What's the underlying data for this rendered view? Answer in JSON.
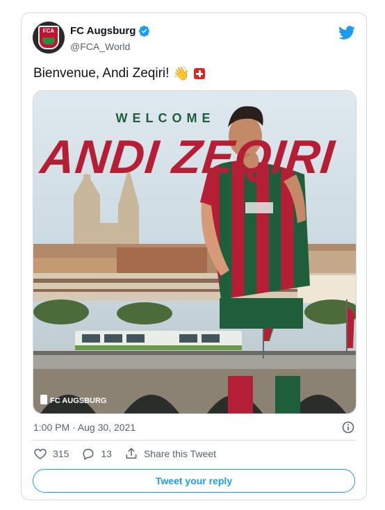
{
  "tweet": {
    "display_name": "FC Augsburg",
    "handle": "@FCA_World",
    "verified": true,
    "text": "Bienvenue, Andi Zeqiri!",
    "emojis": [
      "waving-hands-emoji",
      "swiss-flag-emoji"
    ],
    "timestamp": "1:00 PM · Aug 30, 2021"
  },
  "avatar": {
    "crest_text": "FCA"
  },
  "media": {
    "heading": "WELCOME",
    "player_name": "ANDI ZEQIRI",
    "watermark": "FC AUGSBURG",
    "colors": {
      "red": "#b51f36",
      "green": "#1f5e3a",
      "sky": "#cfdde6"
    }
  },
  "actions": {
    "likes": "315",
    "replies": "13",
    "share_label": "Share this Tweet"
  },
  "reply_button": {
    "label": "Tweet your reply"
  },
  "colors": {
    "accent": "#1d9bf0",
    "text": "#0f1419",
    "muted": "#536471",
    "border": "#cfd9de"
  }
}
